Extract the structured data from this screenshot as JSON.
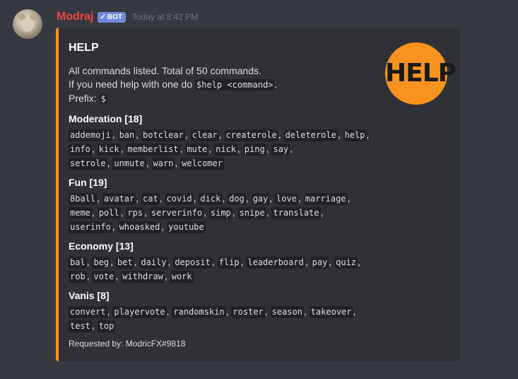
{
  "message": {
    "username": "Modraj",
    "bot_tag": "BOT",
    "timestamp": "Today at 8:42 PM"
  },
  "embed": {
    "title": "HELP",
    "thumbnail_text": "HELP",
    "accent_color": "#f7931e",
    "description_line1": "All commands listed. Total of 50 commands.",
    "description_line2_prefix": "If you need help with one do ",
    "description_line2_code": "$help <command>",
    "description_line2_suffix": ".",
    "prefix_label": "Prefix: ",
    "prefix_code": "$",
    "fields": [
      {
        "name": "Moderation [18]",
        "commands": [
          "addemoji",
          "ban",
          "botclear",
          "clear",
          "createrole",
          "deleterole",
          "help",
          "info",
          "kick",
          "memberlist",
          "mute",
          "nick",
          "ping",
          "say",
          "setrole",
          "unmute",
          "warn",
          "welcomer"
        ],
        "lines": [
          7,
          7,
          4
        ]
      },
      {
        "name": "Fun [19]",
        "commands": [
          "8ball",
          "avatar",
          "cat",
          "covid",
          "dick",
          "dog",
          "gay",
          "love",
          "marriage",
          "meme",
          "poll",
          "rps",
          "serverinfo",
          "simp",
          "snipe",
          "translate",
          "userinfo",
          "whoasked",
          "youtube"
        ],
        "lines": [
          9,
          7,
          3
        ]
      },
      {
        "name": "Economy [13]",
        "commands": [
          "bal",
          "beg",
          "bet",
          "daily",
          "deposit",
          "flip",
          "leaderboard",
          "pay",
          "quiz",
          "rob",
          "vote",
          "withdraw",
          "work"
        ],
        "lines": [
          9,
          4
        ]
      },
      {
        "name": "Vanis [8]",
        "commands": [
          "convert",
          "playervote",
          "randomskin",
          "roster",
          "season",
          "takeover",
          "test",
          "top"
        ],
        "lines": [
          6,
          2
        ]
      }
    ],
    "footer": "Requested by: ModricFX#9818"
  }
}
